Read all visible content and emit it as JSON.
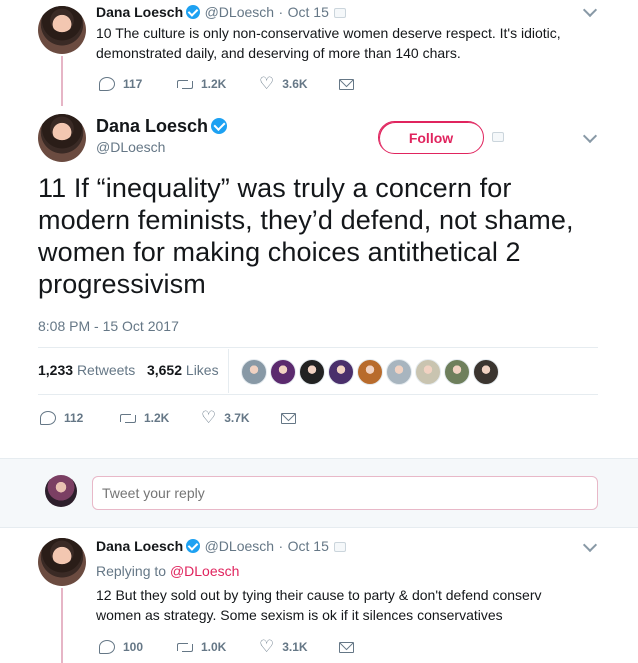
{
  "tweet_top": {
    "name": "Dana Loesch",
    "handle": "@DLoesch",
    "date": "Oct 15",
    "text_line1": "10 The culture is only non-conservative women deserve respect. It's idiotic,",
    "text_line2": "demonstrated daily, and deserving of more than 140 chars.",
    "replies": "117",
    "retweets": "1.2K",
    "likes": "3.6K"
  },
  "main_tweet": {
    "name": "Dana Loesch",
    "handle": "@DLoesch",
    "follow_label": "Follow",
    "text": "11 If “inequality” was truly a concern for modern feminists, they’d defend, not shame, women for making choices antithetical 2 progressivism",
    "timestamp": "8:08 PM - 15 Oct 2017",
    "retweets_count": "1,233",
    "retweets_label": "Retweets",
    "likes_count": "3,652",
    "likes_label": "Likes",
    "replies": "112",
    "retweets": "1.2K",
    "likes": "3.7K"
  },
  "likers": [
    "#8899a6",
    "#5b2a6e",
    "#222222",
    "#4a2f6b",
    "#b86b2c",
    "#a8b5bf",
    "#c9c4b0",
    "#6e7f5c",
    "#3b3530"
  ],
  "reply_box": {
    "placeholder": "Tweet your reply"
  },
  "tweet_bottom": {
    "name": "Dana Loesch",
    "handle": "@DLoesch",
    "date": "Oct 15",
    "replying_to_label": "Replying to",
    "replying_to_handle": "@DLoesch",
    "text_line1": "12 But they sold out by tying their cause to party & don't defend conserv",
    "text_line2": "women as strategy. Some sexism is ok if it silences conservatives",
    "replies": "100",
    "retweets": "1.0K",
    "likes": "3.1K"
  },
  "colors": {
    "accent": "#e0245e",
    "verified": "#1da1f2",
    "muted": "#657786",
    "thread": "#e6b5c6"
  }
}
